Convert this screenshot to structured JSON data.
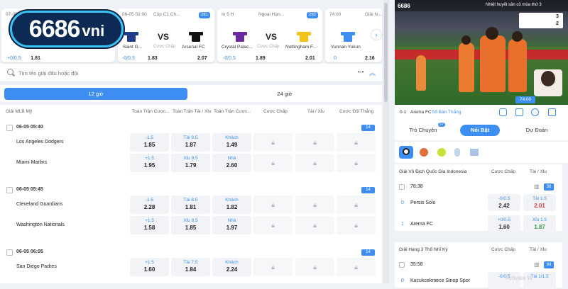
{
  "logo": {
    "number": "6686",
    "suffix": "vni"
  },
  "cards": [
    {
      "date": "07-05",
      "league": "",
      "home": "",
      "away": "",
      "hoff": "+0/0.5",
      "hodds": "1.81"
    },
    {
      "date": "06-05 02:00",
      "league": "Cúp C1 Ch...",
      "count": "281",
      "home": "Saint G...",
      "away": "Arsenal FC",
      "mid": "Cược Chấp",
      "hoff": "-0/0.5",
      "hodds": "1.83",
      "aodds": "2.07",
      "home_color": "#1f3a8c",
      "away_color": "#111111"
    },
    {
      "date": "In 5 H",
      "league": "Ngoại Hạn...",
      "count": "292",
      "home": "Crystal Palac...",
      "away": "Nottingham F...",
      "mid": "Cược Chấp",
      "hoff": "-0/0.5",
      "hodds": "1.89",
      "aodds": "2.01",
      "home_color": "#6a2aa0",
      "away_color": "#f2c21a"
    },
    {
      "date": "74:00",
      "league": "Giải N...",
      "home": "Yunnan Yukun",
      "away": "",
      "hoff": "0",
      "hodds": "2.16",
      "home_color": "#3d8ef0"
    }
  ],
  "search": {
    "placeholder": "Tìm tên giải đấu hoặc đội"
  },
  "time_tabs": {
    "tab1": "12 giờ",
    "tab2": "24 giờ"
  },
  "table": {
    "league": "Giải MLB Mỹ",
    "headers": [
      "Toàn Trận Cược...",
      "Toàn Trận Tài / Xỉu",
      "Toàn Trận Cược...",
      "Cược Chấp",
      "Tài / Xỉu",
      "Cược Đôi Thắng"
    ],
    "games": [
      {
        "date": "06-05 05:40",
        "count": "14",
        "rows": [
          {
            "team": "Los Angeles Dodgers",
            "c1h": "-1.5",
            "c1v": "1.85",
            "c2h": "Tài 9.5",
            "c2v": "1.87",
            "c3h": "Khách",
            "c3v": "1.49"
          },
          {
            "team": "Miami Marlins",
            "c1h": "+1.5",
            "c1v": "1.95",
            "c2h": "Xỉu 9.5",
            "c2v": "1.79",
            "c3h": "Nhà",
            "c3v": "2.60"
          }
        ]
      },
      {
        "date": "06-05 05:45",
        "count": "14",
        "rows": [
          {
            "team": "Cleveland Guardians",
            "c1h": "-1.5",
            "c1v": "2.28",
            "c2h": "Tài 8.5",
            "c2v": "1.81",
            "c3h": "Khách",
            "c3v": "1.82"
          },
          {
            "team": "Washington Nationals",
            "c1h": "+1.5",
            "c1v": "1.58",
            "c2h": "Xỉu 8.5",
            "c2v": "1.85",
            "c3h": "Nhà",
            "c3v": "1.97"
          }
        ]
      },
      {
        "date": "06-05 06:05",
        "count": "14",
        "rows": [
          {
            "team": "San Diego Padres",
            "c1h": "+1.5",
            "c1v": "1.60",
            "c2h": "Tài 7.5",
            "c2v": "1.84",
            "c3h": "Khách",
            "c3v": "2.24"
          }
        ]
      }
    ]
  },
  "video": {
    "brand": "6686",
    "headline": "Nhiệt huyết sân cỏ mùa thứ 3",
    "home_score": "3",
    "away_score": "2",
    "time": "74:00"
  },
  "match_info": {
    "score": "0-1",
    "label": "Arema FC",
    "link": "Sổ Bàn Thắng"
  },
  "panel_tabs": {
    "chat": "Trò Chuyện",
    "chat_badge": "57",
    "featured": "Nổi Bật",
    "predict": "Dự Đoán"
  },
  "right_leagues": [
    {
      "name": "Giải Vô Địch Quốc Gia Indonesia",
      "h1": "Cược Chấp",
      "h2": "Tài / Xỉu",
      "time": "78:38",
      "count": "38",
      "teams": [
        {
          "score": "0",
          "name": "Persis Solo",
          "a_h": "-0/0.5",
          "a_v": "2.42",
          "b_h": "Tài 1.5",
          "b_v": "2.01",
          "b_color": "#d63a3a"
        },
        {
          "score": "1",
          "name": "Arema FC",
          "a_h": "+0/0.5",
          "a_v": "1.60",
          "b_h": "Xỉu 1.5",
          "b_v": "1.87",
          "b_color": "#3ca03c"
        }
      ]
    },
    {
      "name": "Giải Hạng 3 Thổ Nhĩ Kỳ",
      "h1": "Cược Chấp",
      "h2": "Tài / Xỉu",
      "time": "35:58",
      "count": "64",
      "teams": [
        {
          "score": "0",
          "name": "Kucukcekmece Sinop Spor",
          "a_h": "-0/0.5",
          "a_v": "",
          "b_h": "Tài 1/1.5",
          "b_v": "",
          "b_color": "#222"
        }
      ]
    }
  ],
  "watermark": "Activate W"
}
